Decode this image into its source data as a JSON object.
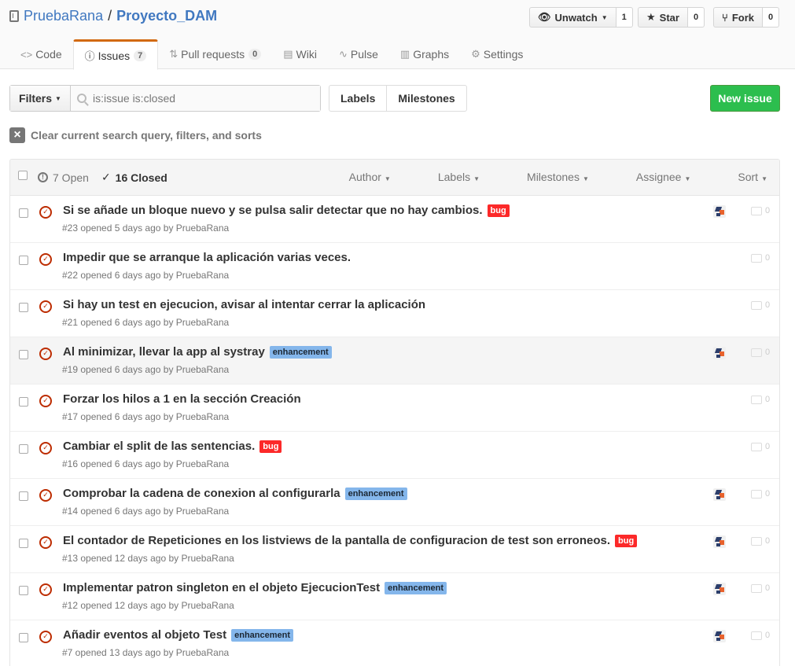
{
  "repo": {
    "owner": "PruebaRana",
    "separator": "/",
    "name": "Proyecto_DAM"
  },
  "actions": {
    "watch": {
      "label": "Unwatch",
      "count": "1"
    },
    "star": {
      "label": "Star",
      "count": "0"
    },
    "fork": {
      "label": "Fork",
      "count": "0"
    }
  },
  "tabs": [
    {
      "label": "Code"
    },
    {
      "label": "Issues",
      "count": "7"
    },
    {
      "label": "Pull requests",
      "count": "0"
    },
    {
      "label": "Wiki"
    },
    {
      "label": "Pulse"
    },
    {
      "label": "Graphs"
    },
    {
      "label": "Settings"
    }
  ],
  "subnav": {
    "filters_label": "Filters",
    "search_value": "is:issue is:closed",
    "labels_label": "Labels",
    "milestones_label": "Milestones",
    "new_issue_label": "New issue"
  },
  "clear_text": "Clear current search query, filters, and sorts",
  "list_header": {
    "open_label": "7 Open",
    "closed_label": "16 Closed",
    "menus": [
      "Author",
      "Labels",
      "Milestones",
      "Assignee",
      "Sort"
    ]
  },
  "issues": [
    {
      "title": "Si se añade un bloque nuevo y se pulsa salir detectar que no hay cambios.",
      "label": "bug",
      "meta": "#23 opened 5 days ago by PruebaRana",
      "avatar": true,
      "comments": "0"
    },
    {
      "title": "Impedir que se arranque la aplicación varias veces.",
      "label": "",
      "meta": "#22 opened 6 days ago by PruebaRana",
      "avatar": false,
      "comments": "0"
    },
    {
      "title": "Si hay un test en ejecucion, avisar al intentar cerrar la aplicación",
      "label": "",
      "meta": "#21 opened 6 days ago by PruebaRana",
      "avatar": false,
      "comments": "0"
    },
    {
      "title": "Al minimizar, llevar la app al systray",
      "label": "enhancement",
      "meta": "#19 opened 6 days ago by PruebaRana",
      "avatar": true,
      "comments": "0"
    },
    {
      "title": "Forzar los hilos a 1 en la sección Creación",
      "label": "",
      "meta": "#17 opened 6 days ago by PruebaRana",
      "avatar": false,
      "comments": "0"
    },
    {
      "title": "Cambiar el split de las sentencias.",
      "label": "bug",
      "meta": "#16 opened 6 days ago by PruebaRana",
      "avatar": false,
      "comments": "0"
    },
    {
      "title": "Comprobar la cadena de conexion al configurarla",
      "label": "enhancement",
      "meta": "#14 opened 6 days ago by PruebaRana",
      "avatar": true,
      "comments": "0"
    },
    {
      "title": "El contador de Repeticiones en los listviews de la pantalla de configuracion de test son erroneos.",
      "label": "bug",
      "meta": "#13 opened 12 days ago by PruebaRana",
      "avatar": true,
      "comments": "0"
    },
    {
      "title": "Implementar patron singleton en el objeto EjecucionTest",
      "label": "enhancement",
      "meta": "#12 opened 12 days ago by PruebaRana",
      "avatar": true,
      "comments": "0"
    },
    {
      "title": "Añadir eventos al objeto Test",
      "label": "enhancement",
      "meta": "#7 opened 13 days ago by PruebaRana",
      "avatar": true,
      "comments": "0"
    }
  ],
  "colors": {
    "closed": "#bd2c00",
    "bug": "#fc2929",
    "enhancement": "#84b6eb",
    "new_issue": "#2cbe4e",
    "tab_accent": "#d26911"
  }
}
